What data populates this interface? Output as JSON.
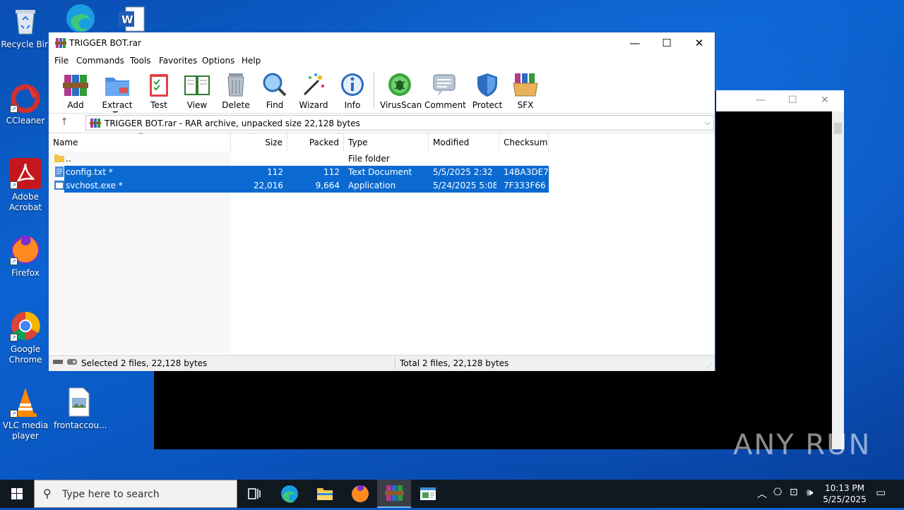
{
  "desktop": {
    "icons": [
      {
        "label": "Recycle Bin"
      },
      {
        "label": "CCleaner"
      },
      {
        "label": "Adobe Acrobat"
      },
      {
        "label": "Firefox"
      },
      {
        "label": "Google Chrome"
      },
      {
        "label": "VLC media player"
      },
      {
        "label": "frontaccou..."
      }
    ]
  },
  "winrar": {
    "title": "TRIGGER BOT.rar",
    "menu": [
      "File",
      "Commands",
      "Tools",
      "Favorites",
      "Options",
      "Help"
    ],
    "toolbar": [
      "Add",
      "Extract To",
      "Test",
      "View",
      "Delete",
      "Find",
      "Wizard",
      "Info",
      "VirusScan",
      "Comment",
      "Protect",
      "SFX"
    ],
    "address": "TRIGGER BOT.rar - RAR archive, unpacked size 22,128 bytes",
    "columns": [
      "Name",
      "Size",
      "Packed",
      "Type",
      "Modified",
      "Checksum"
    ],
    "rows": [
      {
        "name": "..",
        "size": "",
        "packed": "",
        "type": "File folder",
        "modified": "",
        "checksum": "",
        "selected": false
      },
      {
        "name": "config.txt *",
        "size": "112",
        "packed": "112",
        "type": "Text Document",
        "modified": "5/5/2025 2:32 ...",
        "checksum": "14BA3DE7",
        "selected": true
      },
      {
        "name": "svchost.exe *",
        "size": "22,016",
        "packed": "9,664",
        "type": "Application",
        "modified": "5/24/2025 5:08 ...",
        "checksum": "7F333F66",
        "selected": true
      }
    ],
    "status_left": "Selected 2 files, 22,128 bytes",
    "status_right": "Total 2 files, 22,128 bytes"
  },
  "taskbar": {
    "search_placeholder": "Type here to search",
    "time": "10:13 PM",
    "date": "5/25/2025"
  },
  "watermark": "ANY RUN",
  "colors": {
    "selection": "#0a6ad1",
    "desktop": "#0b63d1",
    "taskbar": "#101820"
  }
}
